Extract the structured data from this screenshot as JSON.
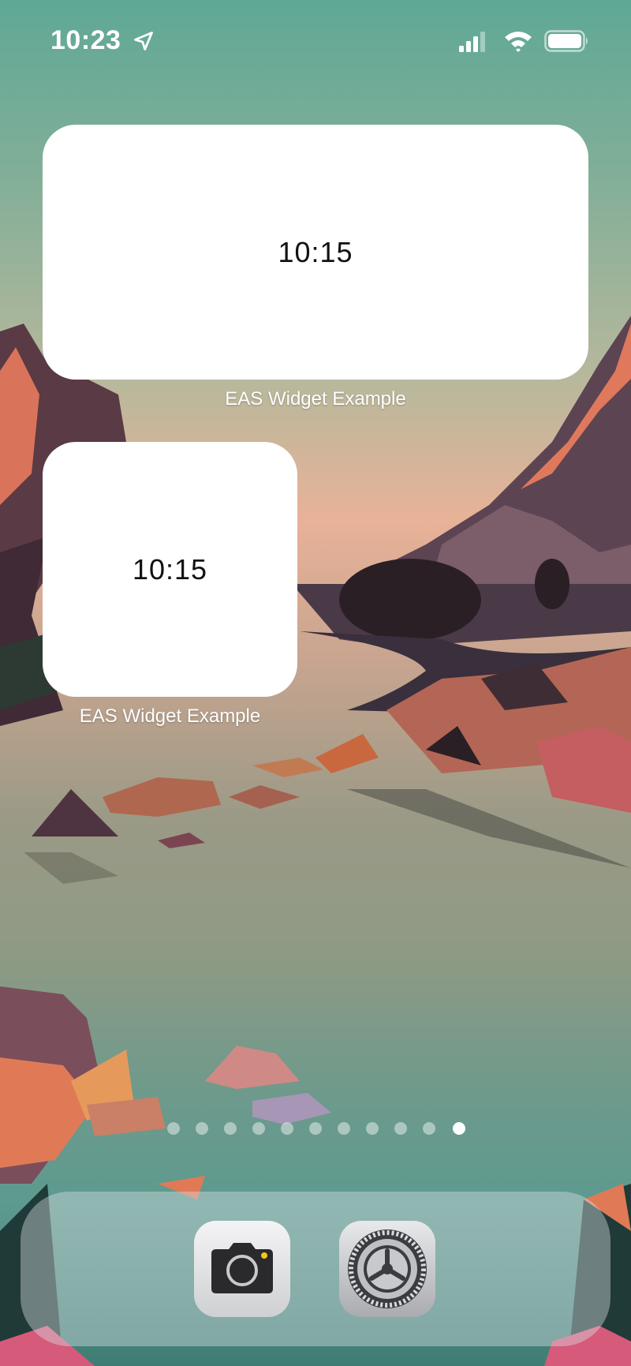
{
  "status_bar": {
    "time": "10:23",
    "icons": [
      "location-arrow-icon",
      "cellular-signal-icon",
      "wifi-icon",
      "battery-icon"
    ]
  },
  "widgets": [
    {
      "size": "medium",
      "time": "10:15",
      "label": "EAS Widget Example"
    },
    {
      "size": "small",
      "time": "10:15",
      "label": "EAS Widget Example"
    }
  ],
  "page_indicator": {
    "count": 11,
    "active_index": 10
  },
  "dock": {
    "apps": [
      {
        "name": "Camera",
        "icon": "camera-icon"
      },
      {
        "name": "Settings",
        "icon": "settings-gear-icon"
      }
    ]
  }
}
